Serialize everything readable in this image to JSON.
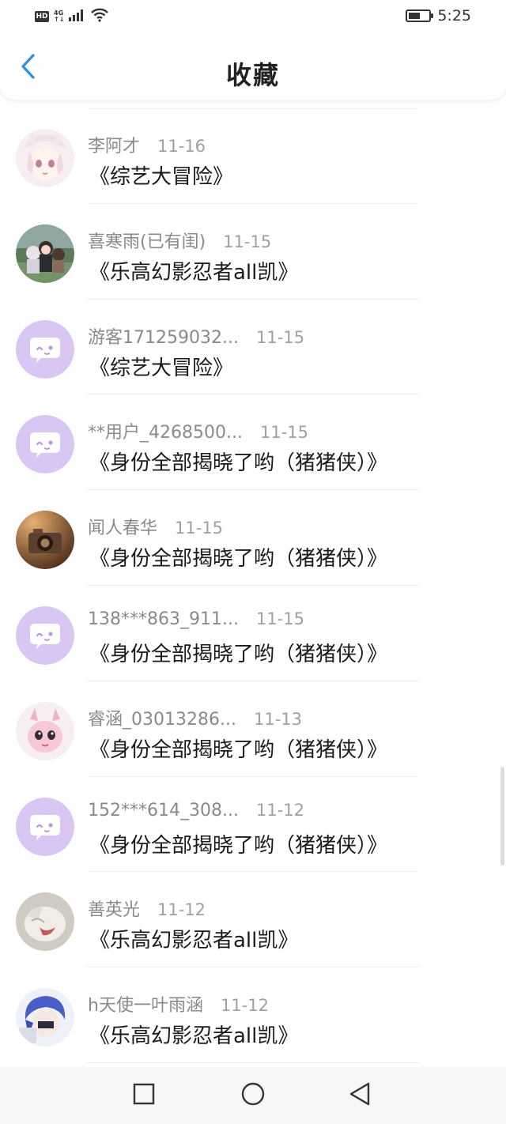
{
  "status_bar": {
    "hd": "HD",
    "network_top": "4G",
    "network_bottom": "↑↓",
    "battery_percent": 60,
    "time": "5:25"
  },
  "header": {
    "title": "收藏",
    "back_icon": "chevron-left-icon",
    "accent": "#2f8fe0"
  },
  "favorites": [
    {
      "user": "李阿才",
      "date": "11-16",
      "title": "《综艺大冒险》",
      "avatar": "anime-avatar-pink"
    },
    {
      "user": "喜寒雨(已有闺)",
      "date": "11-15",
      "title": "《乐高幻影忍者all凯》",
      "avatar": "anime-avatar-group"
    },
    {
      "user": "游客171259032...",
      "date": "11-15",
      "title": "《综艺大冒险》",
      "avatar": "default-chat-avatar"
    },
    {
      "user": "**用户_4268500...",
      "date": "11-15",
      "title": "《身份全部揭晓了哟（猪猪侠）》",
      "avatar": "default-chat-avatar"
    },
    {
      "user": "闻人春华",
      "date": "11-15",
      "title": "《身份全部揭晓了哟（猪猪侠）》",
      "avatar": "camera-avatar"
    },
    {
      "user": "138***863_911...",
      "date": "11-15",
      "title": "《身份全部揭晓了哟（猪猪侠）》",
      "avatar": "default-chat-avatar"
    },
    {
      "user": "睿涵_03013286...",
      "date": "11-13",
      "title": "《身份全部揭晓了哟（猪猪侠）》",
      "avatar": "dragon-avatar"
    },
    {
      "user": "152***614_308...",
      "date": "11-12",
      "title": "《身份全部揭晓了哟（猪猪侠）》",
      "avatar": "default-chat-avatar"
    },
    {
      "user": "善英光",
      "date": "11-12",
      "title": "《乐高幻影忍者all凯》",
      "avatar": "cat-avatar"
    },
    {
      "user": "h天使一叶雨涵",
      "date": "11-12",
      "title": "《乐高幻影忍者all凯》",
      "avatar": "anime-avatar-blue"
    }
  ],
  "nav_bar": {
    "recents_icon": "square-icon",
    "home_icon": "circle-icon",
    "back_icon": "triangle-back-icon"
  },
  "colors": {
    "default_avatar_bg": "#d9c6f2",
    "username": "#8a8a8a",
    "date": "#a0a0a0"
  }
}
